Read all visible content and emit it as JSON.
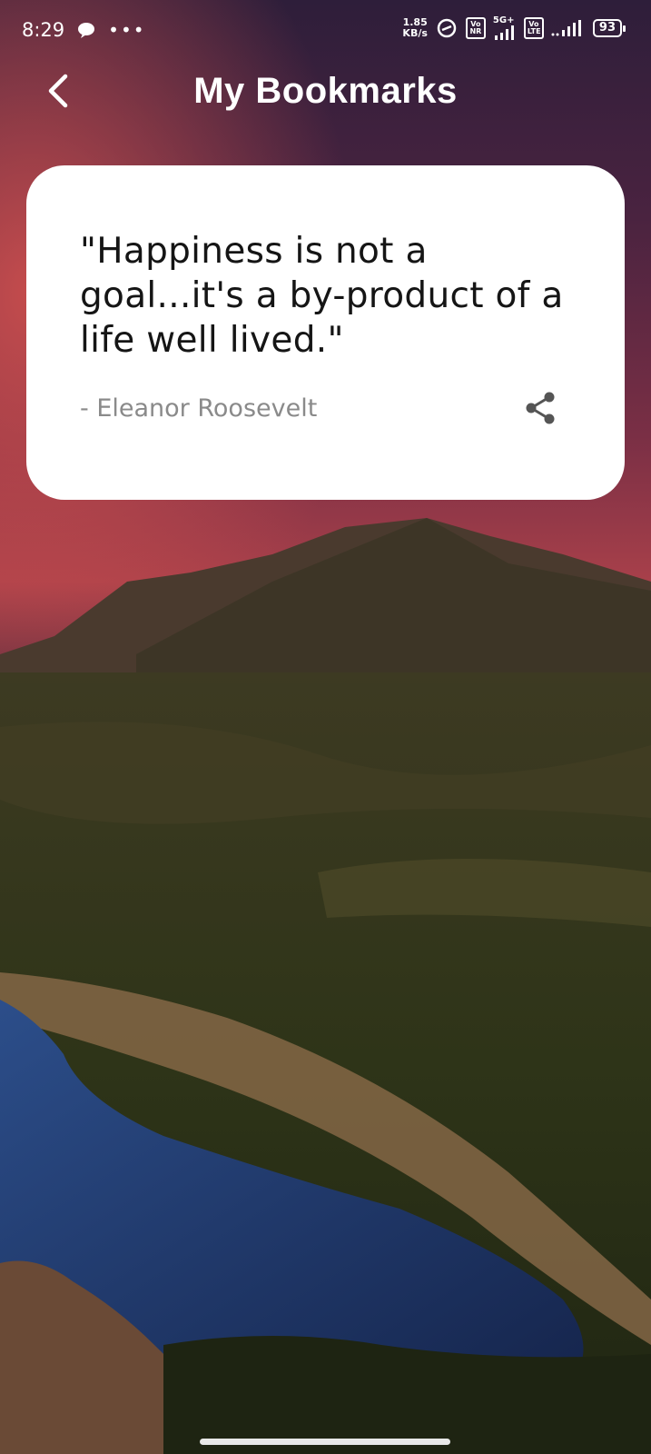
{
  "status_bar": {
    "time": "8:29",
    "net_speed_value": "1.85",
    "net_speed_unit": "KB/s",
    "sim1_badge_top": "Vo",
    "sim1_badge_bottom": "NR",
    "sim1_network": "5G+",
    "sim2_badge_top": "Vo",
    "sim2_badge_bottom": "LTE",
    "battery": "93"
  },
  "header": {
    "title": "My Bookmarks",
    "back_icon": "chevron-left-icon"
  },
  "bookmark": {
    "quote": "\"Happiness is not a goal...it's a by-product of a life well lived.\"",
    "author": "- Eleanor Roosevelt",
    "share_icon": "share-icon"
  },
  "colors": {
    "card_bg": "#ffffff",
    "quote_text": "#151515",
    "author_text": "#8a8a8a",
    "sky_top": "#3a1f3e",
    "sky_glow": "#b0404a"
  }
}
